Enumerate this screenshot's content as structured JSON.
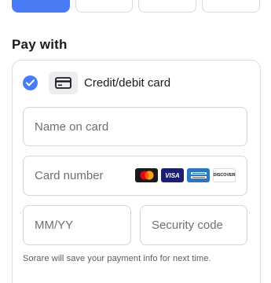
{
  "payment": {
    "title": "Pay with",
    "method": {
      "label": "Credit/debit card",
      "selected": true,
      "icon": "credit-card-icon"
    },
    "fields": {
      "name_placeholder": "Name on card",
      "number_placeholder": "Card number",
      "expiry_placeholder": "MM/YY",
      "cvc_placeholder": "Security code"
    },
    "card_brands": [
      {
        "name": "Mastercard",
        "icon": "mastercard-icon"
      },
      {
        "name": "Visa",
        "text": "VISA",
        "icon": "visa-icon"
      },
      {
        "name": "American Express",
        "icon": "amex-icon"
      },
      {
        "name": "Discover",
        "text": "DISCOVER",
        "icon": "discover-icon"
      }
    ],
    "save_note": "Sorare will save your payment info for next time."
  },
  "colors": {
    "accent": "#4a7cf5",
    "border": "#d4d4da",
    "icon_bg": "#ecedf1"
  }
}
